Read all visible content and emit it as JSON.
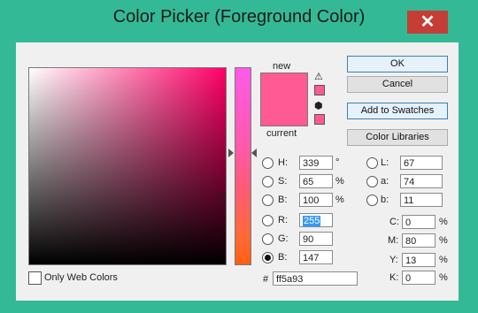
{
  "window": {
    "title": "Color Picker (Foreground Color)",
    "close_glyph": "✕"
  },
  "preview": {
    "new_label": "new",
    "current_label": "current",
    "new_color": "#ff5a93",
    "current_color": "#ff5a93",
    "gamut_warning_icon": "warning-triangle-icon",
    "web_safe_icon": "cube-icon"
  },
  "buttons": {
    "ok": "OK",
    "cancel": "Cancel",
    "add_to_swatches": "Add to Swatches",
    "color_libraries": "Color Libraries"
  },
  "hsb": {
    "h_label": "H:",
    "h_value": "339",
    "h_unit": "°",
    "s_label": "S:",
    "s_value": "65",
    "s_unit": "%",
    "b_label": "B:",
    "b_value": "100",
    "b_unit": "%"
  },
  "rgb": {
    "r_label": "R:",
    "r_value": "255",
    "g_label": "G:",
    "g_value": "90",
    "b_label": "B:",
    "b_value": "147"
  },
  "lab": {
    "l_label": "L:",
    "l_value": "67",
    "a_label": "a:",
    "a_value": "74",
    "b_label": "b:",
    "b_value": "11"
  },
  "cmyk": {
    "c_label": "C:",
    "c_value": "0",
    "m_label": "M:",
    "m_value": "80",
    "y_label": "Y:",
    "y_value": "13",
    "k_label": "K:",
    "k_value": "0",
    "unit": "%"
  },
  "hex": {
    "label": "#",
    "value": "ff5a93"
  },
  "options": {
    "only_web_colors_label": "Only Web Colors",
    "only_web_colors_checked": false
  },
  "colors": {
    "accent": "#34b996",
    "close": "#c63d35",
    "field_hue": "#ff0066"
  }
}
